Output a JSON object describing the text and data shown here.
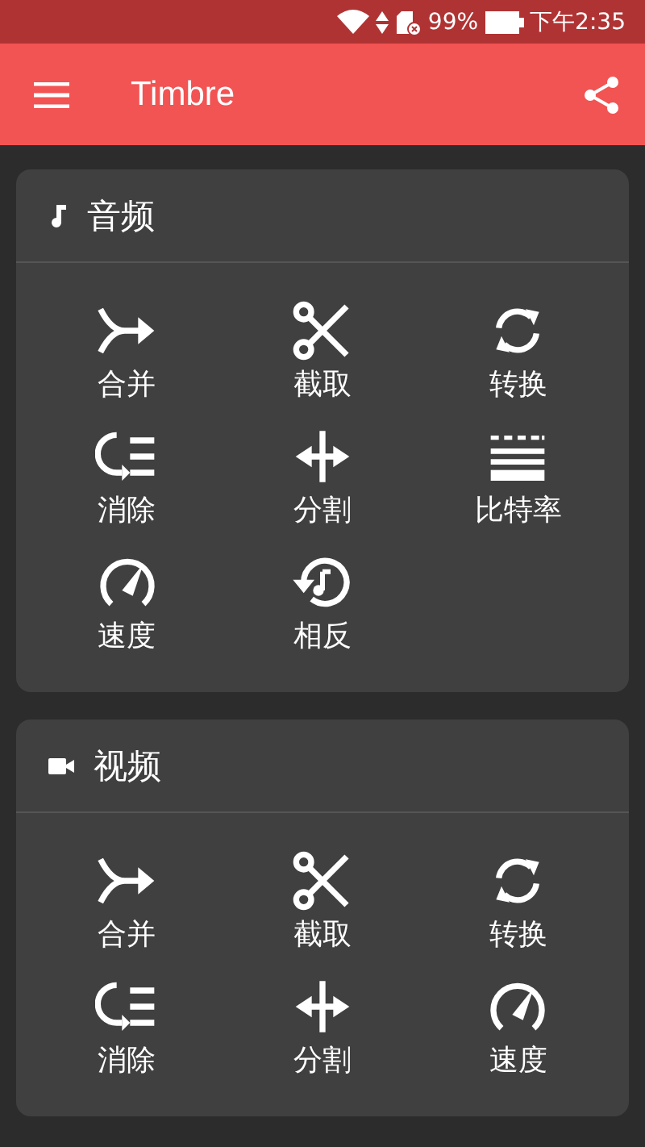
{
  "status_bar": {
    "battery": "99%",
    "time": "下午2:35"
  },
  "app_bar": {
    "title": "Timbre"
  },
  "sections": [
    {
      "kind": "audio",
      "title": "音频",
      "items": [
        {
          "kind": "merge",
          "label": "合并"
        },
        {
          "kind": "cut",
          "label": "截取"
        },
        {
          "kind": "convert",
          "label": "转换"
        },
        {
          "kind": "remove",
          "label": "消除"
        },
        {
          "kind": "split",
          "label": "分割"
        },
        {
          "kind": "bitrate",
          "label": "比特率"
        },
        {
          "kind": "speed",
          "label": "速度"
        },
        {
          "kind": "reverse",
          "label": "相反"
        }
      ]
    },
    {
      "kind": "video",
      "title": "视频",
      "items": [
        {
          "kind": "merge",
          "label": "合并"
        },
        {
          "kind": "cut",
          "label": "截取"
        },
        {
          "kind": "convert",
          "label": "转换"
        },
        {
          "kind": "remove",
          "label": "消除"
        },
        {
          "kind": "split",
          "label": "分割"
        },
        {
          "kind": "speed",
          "label": "速度"
        }
      ]
    }
  ]
}
